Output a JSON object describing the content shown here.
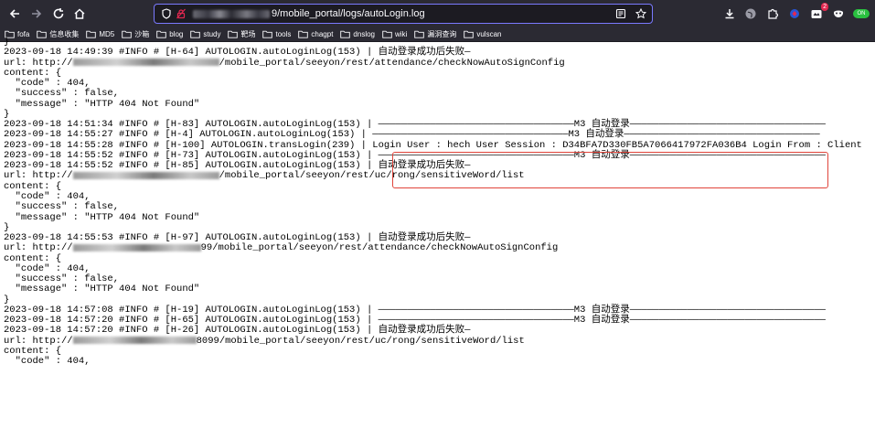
{
  "browser": {
    "url_visible": "9/mobile_portal/logs/autoLogin.log",
    "extension_badge": "2",
    "extension_pill": "ON"
  },
  "bookmarks": [
    {
      "label": "fofa"
    },
    {
      "label": "信息收集"
    },
    {
      "label": "MD5"
    },
    {
      "label": "沙箱"
    },
    {
      "label": "blog"
    },
    {
      "label": "study"
    },
    {
      "label": "靶场"
    },
    {
      "label": "tools"
    },
    {
      "label": "chagpt"
    },
    {
      "label": "dnslog"
    },
    {
      "label": "wiki"
    },
    {
      "label": "漏洞查询"
    },
    {
      "label": "vulscan"
    }
  ],
  "log": {
    "lines": [
      {
        "text": "}"
      },
      {
        "text": "2023-09-18 14:49:39 #INFO # [H-64] AUTOLOGIN.autoLoginLog(153) | 自动登录成功后失败—"
      },
      {
        "prefix": "url: http://",
        "suffix": "/mobile_portal/seeyon/rest/attendance/checkNowAutoSignConfig",
        "redact_w": 160
      },
      {
        "text": "content: {"
      },
      {
        "text": "  \"code\" : 404,"
      },
      {
        "text": "  \"success\" : false,"
      },
      {
        "text": "  \"message\" : \"HTTP 404 Not Found\""
      },
      {
        "text": "}"
      },
      {
        "text": "2023-09-18 14:51:34 #INFO # [H-83] AUTOLOGIN.autoLoginLog(153) | ——————————————————————————————————M3 自动登录——————————————————————————————————"
      },
      {
        "text": "2023-09-18 14:55:27 #INFO # [H-4] AUTOLOGIN.autoLoginLog(153) | ——————————————————————————————————M3 自动登录——————————————————————————————————"
      },
      {
        "text": "2023-09-18 14:55:28 #INFO # [H-100] AUTOLOGIN.transLogin(239) | Login User : hech User Session : D34BFA7D330FB5A7066417972FA036B4 Login From : Client"
      },
      {
        "text": "2023-09-18 14:55:52 #INFO # [H-73] AUTOLOGIN.autoLoginLog(153) | ——————————————————————————————————M3 自动登录——————————————————————————————————"
      },
      {
        "text": "2023-09-18 14:55:52 #INFO # [H-85] AUTOLOGIN.autoLoginLog(153) | 自动登录成功后失败—"
      },
      {
        "prefix": "url: http://",
        "suffix": "/mobile_portal/seeyon/rest/uc/rong/sensitiveWord/list",
        "redact_w": 160
      },
      {
        "text": "content: {"
      },
      {
        "text": "  \"code\" : 404,"
      },
      {
        "text": "  \"success\" : false,"
      },
      {
        "text": "  \"message\" : \"HTTP 404 Not Found\""
      },
      {
        "text": "}"
      },
      {
        "text": "2023-09-18 14:55:53 #INFO # [H-97] AUTOLOGIN.autoLoginLog(153) | 自动登录成功后失败—"
      },
      {
        "prefix": "url: http://",
        "suffix": "99/mobile_portal/seeyon/rest/attendance/checkNowAutoSignConfig",
        "redact_w": 140
      },
      {
        "text": "content: {"
      },
      {
        "text": "  \"code\" : 404,"
      },
      {
        "text": "  \"success\" : false,"
      },
      {
        "text": "  \"message\" : \"HTTP 404 Not Found\""
      },
      {
        "text": "}"
      },
      {
        "text": "2023-09-18 14:57:08 #INFO # [H-19] AUTOLOGIN.autoLoginLog(153) | ——————————————————————————————————M3 自动登录——————————————————————————————————"
      },
      {
        "text": "2023-09-18 14:57:20 #INFO # [H-65] AUTOLOGIN.autoLoginLog(153) | ——————————————————————————————————M3 自动登录——————————————————————————————————"
      },
      {
        "text": "2023-09-18 14:57:20 #INFO # [H-26] AUTOLOGIN.autoLoginLog(153) | 自动登录成功后失败—"
      },
      {
        "prefix": "url: http://",
        "suffix": "8099/mobile_portal/seeyon/rest/uc/rong/sensitiveWord/list",
        "redact_w": 135
      },
      {
        "text": "content: {"
      },
      {
        "text": "  \"code\" : 404,"
      }
    ]
  }
}
